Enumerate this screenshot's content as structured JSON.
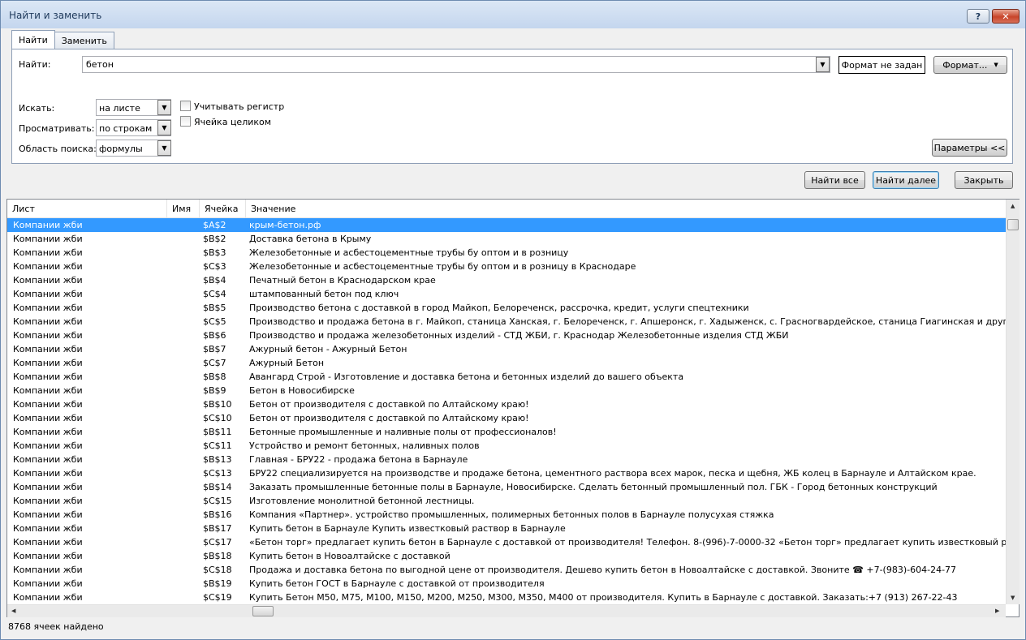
{
  "window": {
    "title": "Найти и заменить",
    "help_label": "?",
    "close_label": "✕"
  },
  "tabs": [
    {
      "label": "Найти"
    },
    {
      "label": "Заменить"
    }
  ],
  "find": {
    "label": "Найти:",
    "value": "бетон",
    "format_status": "Формат не задан",
    "format_button": "Формат..."
  },
  "options": {
    "search_in_label": "Искать:",
    "search_in_value": "на листе",
    "look_through_label": "Просматривать:",
    "look_through_value": "по строкам",
    "look_in_label": "Область поиска:",
    "look_in_value": "формулы",
    "match_case_label": "Учитывать регистр",
    "match_case_checked": false,
    "whole_cell_label": "Ячейка целиком",
    "whole_cell_checked": false,
    "params_button": "Параметры <<"
  },
  "actions": {
    "find_all": "Найти все",
    "find_next": "Найти далее",
    "close": "Закрыть"
  },
  "results": {
    "columns": [
      "Лист",
      "Имя",
      "Ячейка",
      "Значение"
    ],
    "rows": [
      {
        "sheet": "Компании жби",
        "name": "",
        "cell": "$A$2",
        "value": "крым-бетон.рф",
        "selected": true
      },
      {
        "sheet": "Компании жби",
        "name": "",
        "cell": "$B$2",
        "value": "Доставка бетона в Крыму"
      },
      {
        "sheet": "Компании жби",
        "name": "",
        "cell": "$B$3",
        "value": "Железобетонные и асбестоцементные трубы бу оптом и в розницу"
      },
      {
        "sheet": "Компании жби",
        "name": "",
        "cell": "$C$3",
        "value": "Железобетонные и асбестоцементные трубы бу оптом и в розницу в Краснодаре"
      },
      {
        "sheet": "Компании жби",
        "name": "",
        "cell": "$B$4",
        "value": "Печатный бетон в Краснодарском крае"
      },
      {
        "sheet": "Компании жби",
        "name": "",
        "cell": "$C$4",
        "value": "штампованный бетон под ключ"
      },
      {
        "sheet": "Компании жби",
        "name": "",
        "cell": "$B$5",
        "value": "Производство бетона с доставкой в город Майкоп, Белореченск, рассрочка, кредит, услуги спецтехники"
      },
      {
        "sheet": "Компании жби",
        "name": "",
        "cell": "$C$5",
        "value": "Производство и продажа бетона в г. Майкоп, станица Ханская, г. Белореченск, г. Апшеронск, г. Хадыженск, с. Грасногвардейское, станица Гиагинская и другие районы Республик"
      },
      {
        "sheet": "Компании жби",
        "name": "",
        "cell": "$B$6",
        "value": "Производство и продажа железобетонных изделий - СТД ЖБИ, г. Краснодар Железобетонные изделия СТД ЖБИ"
      },
      {
        "sheet": "Компании жби",
        "name": "",
        "cell": "$B$7",
        "value": "Ажурный бетон - Ажурный Бетон"
      },
      {
        "sheet": "Компании жби",
        "name": "",
        "cell": "$C$7",
        "value": "Ажурный Бетон"
      },
      {
        "sheet": "Компании жби",
        "name": "",
        "cell": "$B$8",
        "value": "Авангард Строй - Изготовление и доставка бетона и бетонных изделий до вашего объекта"
      },
      {
        "sheet": "Компании жби",
        "name": "",
        "cell": "$B$9",
        "value": "Бетон в Новосибирске"
      },
      {
        "sheet": "Компании жби",
        "name": "",
        "cell": "$B$10",
        "value": "Бетон от производителя с доставкой по Алтайскому краю!"
      },
      {
        "sheet": "Компании жби",
        "name": "",
        "cell": "$C$10",
        "value": "Бетон от производителя с доставкой по Алтайскому краю!"
      },
      {
        "sheet": "Компании жби",
        "name": "",
        "cell": "$B$11",
        "value": "Бетонные промышленные и наливные полы от профессионалов!"
      },
      {
        "sheet": "Компании жби",
        "name": "",
        "cell": "$C$11",
        "value": "Устройство и ремонт бетонных, наливных полов"
      },
      {
        "sheet": "Компании жби",
        "name": "",
        "cell": "$B$13",
        "value": "Главная - БРУ22 - продажа бетона в Барнауле"
      },
      {
        "sheet": "Компании жби",
        "name": "",
        "cell": "$C$13",
        "value": "БРУ22 специализируется на производстве и продаже бетона, цементного раствора всех марок, песка и щебня, ЖБ колец в Барнауле и Алтайском крае."
      },
      {
        "sheet": "Компании жби",
        "name": "",
        "cell": "$B$14",
        "value": "Заказать промышленные бетонные полы в Барнауле, Новосибирске. Сделать бетонный промышленный пол. ГБК - Город бетонных конструкций"
      },
      {
        "sheet": "Компании жби",
        "name": "",
        "cell": "$C$15",
        "value": "Изготовление монолитной бетонной лестницы."
      },
      {
        "sheet": "Компании жби",
        "name": "",
        "cell": "$B$16",
        "value": "Компания «Партнер». устройство промышленных, полимерных бетонных полов в Барнауле полусухая стяжка"
      },
      {
        "sheet": "Компании жби",
        "name": "",
        "cell": "$B$17",
        "value": "Купить бетон в Барнауле Купить известковый раствор в Барнауле"
      },
      {
        "sheet": "Компании жби",
        "name": "",
        "cell": "$C$17",
        "value": "«Бетон торг» предлагает купить бетон в Барнауле с доставкой от производителя! Телефон. 8-(996)-7-0000-32 «Бетон торг» предлагает купить известковый раствор в Барнауле с д"
      },
      {
        "sheet": "Компании жби",
        "name": "",
        "cell": "$B$18",
        "value": "Купить бетон в Новоалтайске с доставкой"
      },
      {
        "sheet": "Компании жби",
        "name": "",
        "cell": "$C$18",
        "value": "Продажа и доставка бетона по выгодной цене от производителя. Дешево купить бетон в Новоалтайске с доставкой. Звоните ☎ +7-(983)-604-24-77"
      },
      {
        "sheet": "Компании жби",
        "name": "",
        "cell": "$B$19",
        "value": "Купить бетон ГОСТ в Барнауле с доставкой от производителя"
      },
      {
        "sheet": "Компании жби",
        "name": "",
        "cell": "$C$19",
        "value": "Купить Бетон М50, М75, М100, М150, М200, М250, М300, М350, М400 от производителя. Купить в Барнауле с доставкой. Заказать:+7 (913) 267-22-43"
      }
    ]
  },
  "status": {
    "text": "8768 ячеек найдено"
  }
}
